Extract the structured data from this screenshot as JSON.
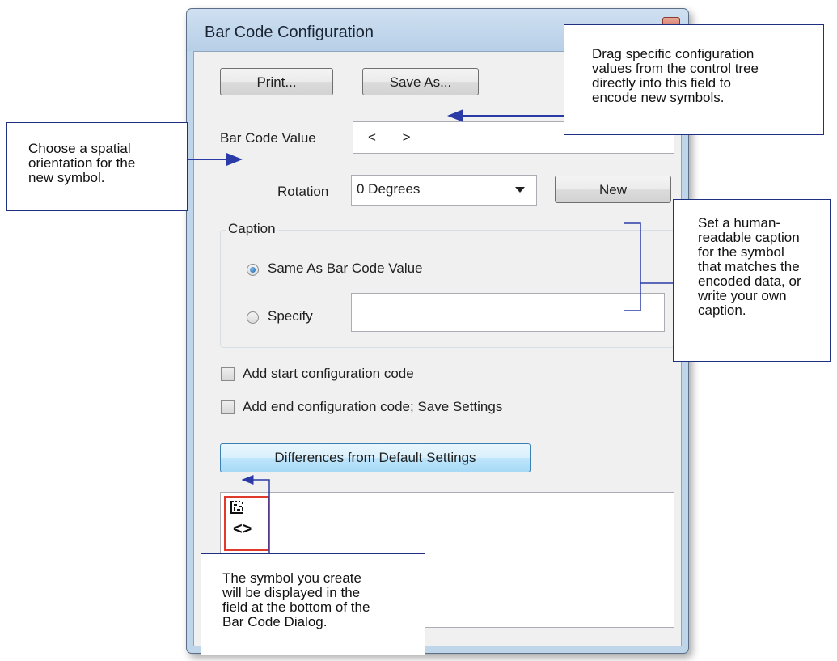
{
  "dialog": {
    "title": "Bar Code Configuration",
    "print_label": "Print...",
    "save_as_label": "Save As...",
    "barcode_value_label": "Bar Code Value",
    "barcode_value": "< >",
    "rotation_label": "Rotation",
    "rotation_value": "0 Degrees",
    "new_label": "New",
    "caption_group_label": "Caption",
    "caption_same_label": "Same As Bar Code Value",
    "caption_specify_label": "Specify",
    "caption_specify_value": "",
    "add_start_label": "Add start configuration code",
    "add_end_label": "Add end configuration code; Save Settings",
    "differences_label": "Differences from Default Settings",
    "preview_symbol_text": "<>"
  },
  "callouts": {
    "drag_values": [
      "Drag specific configuration",
      "values from the control tree",
      "directly into this field to",
      "encode new symbols."
    ],
    "orientation": [
      "Choose a spatial",
      "orientation for the",
      "new symbol."
    ],
    "caption": [
      "Set a human-",
      "readable caption",
      "for the symbol",
      "that matches the",
      "encoded data, or",
      "write your own",
      "caption."
    ],
    "symbol_display": [
      "The symbol you create",
      "will be displayed in the",
      "field at the bottom of the",
      "Bar Code Dialog."
    ]
  },
  "colors": {
    "callout_border": "#1f2f82",
    "arrow": "#2a3ba8",
    "window_frame": "#bfd5ea",
    "symbol_frame": "#e03a2c"
  }
}
